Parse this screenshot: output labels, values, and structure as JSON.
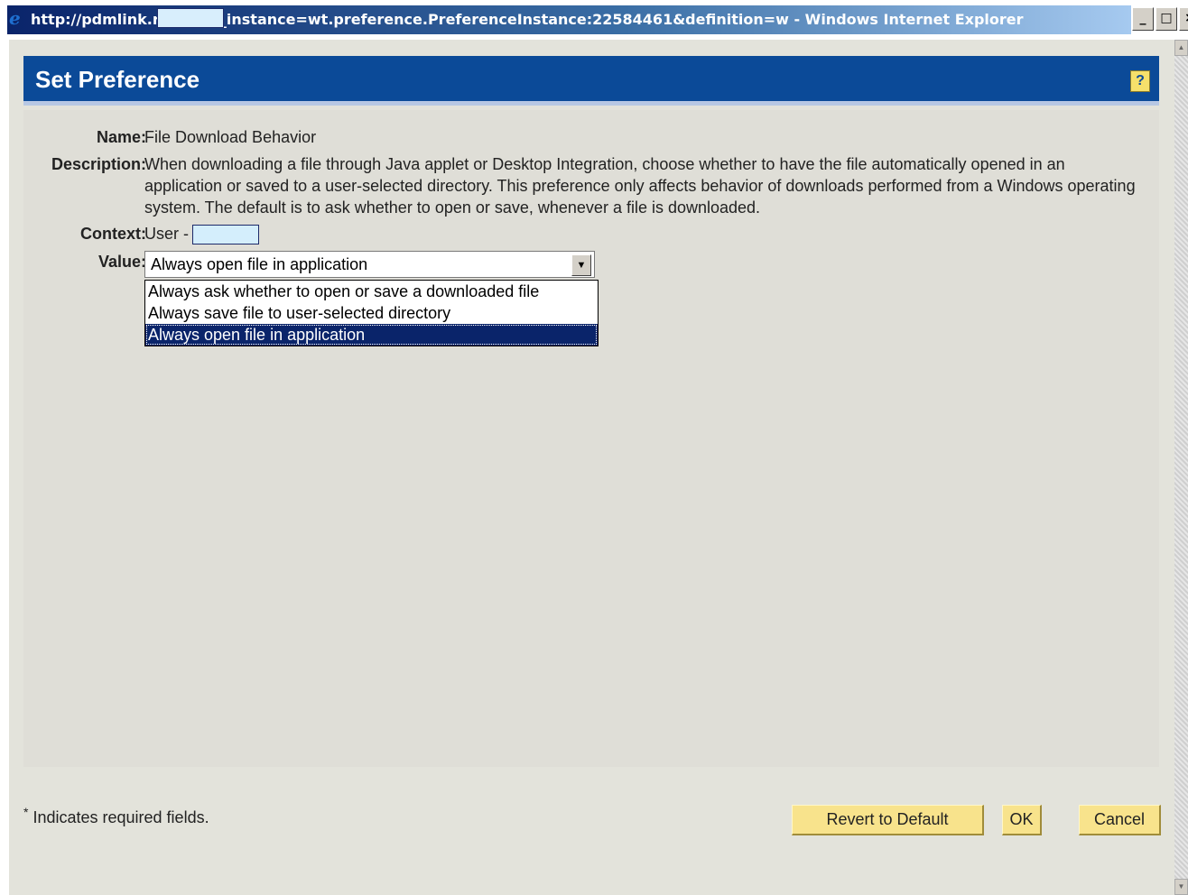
{
  "window": {
    "title": "http://pdmlink.r        n/?this_instance=wt.preference.PreferenceInstance:22584461&definition=w - Windows Internet Explorer",
    "controls": {
      "minimize": "_",
      "maximize": "□",
      "close": "×"
    }
  },
  "header": {
    "title": "Set Preference",
    "help_label": "?"
  },
  "form": {
    "name_label": "Name:",
    "name_value": "File Download Behavior",
    "description_label": "Description:",
    "description_value": "When downloading a file through Java applet or Desktop Integration, choose whether to have the file automatically opened in an application or saved to a user-selected directory. This preference only affects behavior of downloads performed from a Windows operating system. The default is to ask whether to open or save, whenever a file is downloaded.",
    "context_label": "Context:",
    "context_value": "User -",
    "value_label": "Value:",
    "selected_value": "Always open file in application",
    "options": [
      "Always ask whether to open or save a downloaded file",
      "Always save file to user-selected directory",
      "Always open file in application"
    ]
  },
  "footer": {
    "required_asterisk": "*",
    "required_note": "Indicates required fields.",
    "revert_label": "Revert to Default",
    "ok_label": "OK",
    "cancel_label": "Cancel"
  },
  "icons": {
    "browser": "ie-icon",
    "dropdown_arrow": "chevron-down-icon",
    "help": "help-icon"
  },
  "colors": {
    "header_bg": "#0b4a98",
    "button_bg": "#f8e38c",
    "selection_bg": "#0a246a",
    "panel_bg": "#dfded7"
  }
}
